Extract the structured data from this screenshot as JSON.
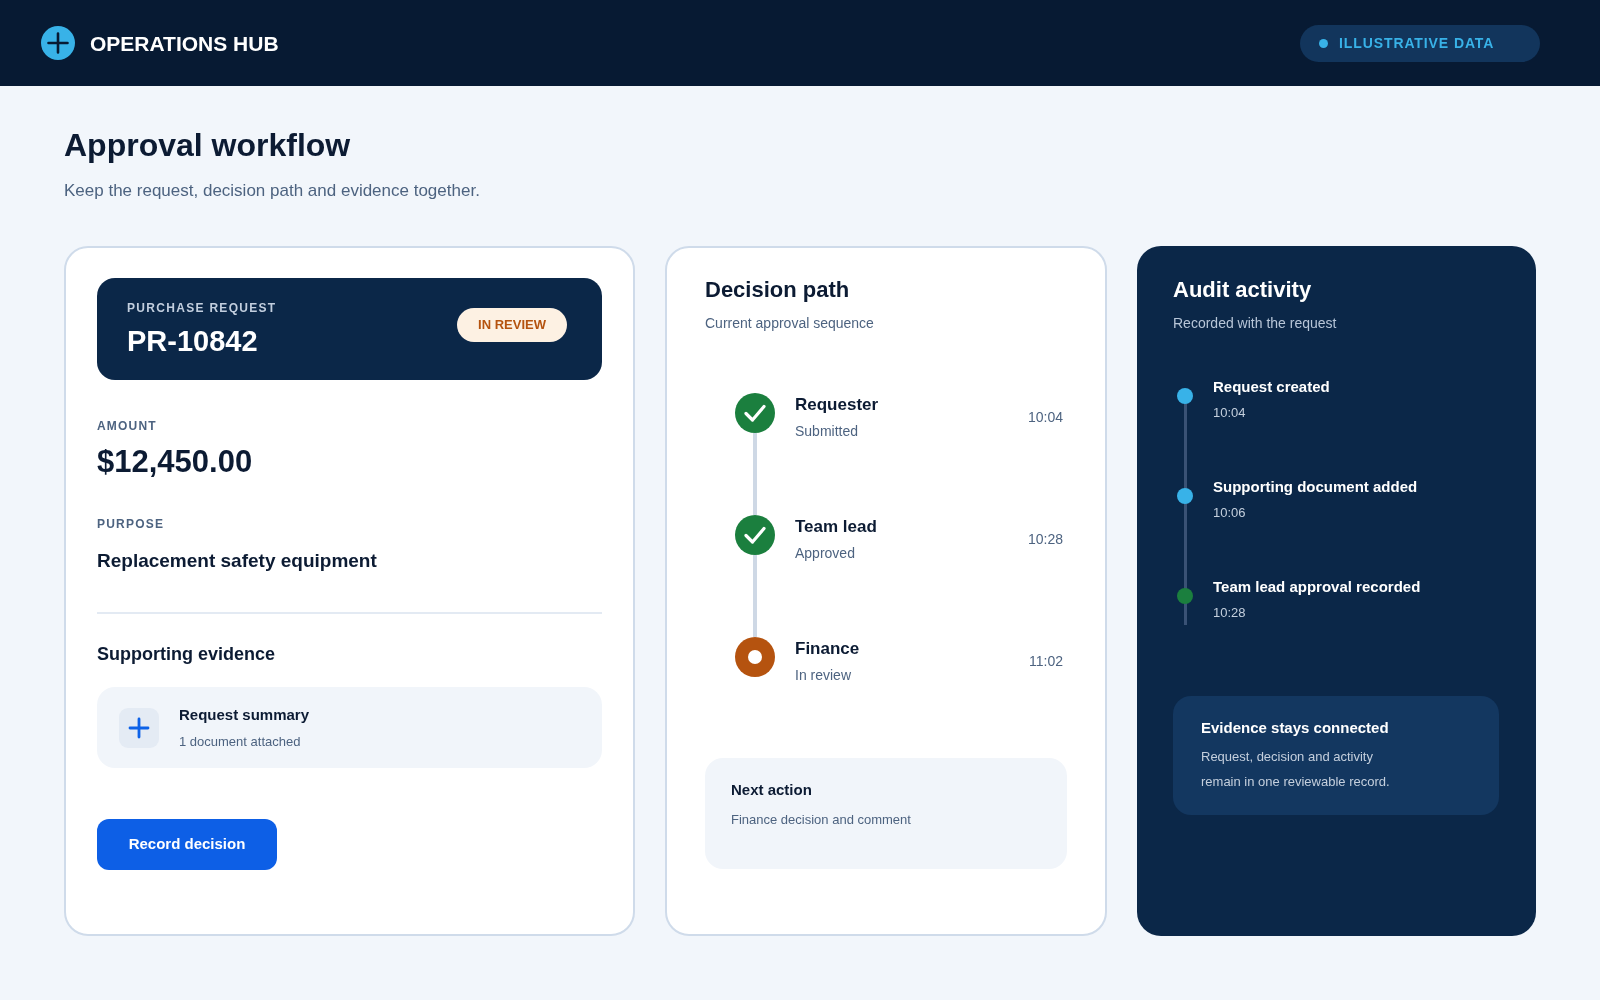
{
  "header": {
    "title": "OPERATIONS HUB",
    "badge": "ILLUSTRATIVE DATA"
  },
  "page": {
    "title": "Approval workflow",
    "subtitle": "Keep the request, decision path and evidence together."
  },
  "request_card": {
    "label": "PURCHASE REQUEST",
    "request_id": "PR-10842",
    "status": "IN REVIEW",
    "fields": [
      {
        "kind": "amount",
        "label": "AMOUNT",
        "value": "$12,450.00"
      },
      {
        "kind": "text",
        "label": "PURPOSE",
        "value": "Replacement safety equipment"
      }
    ],
    "evidence": {
      "title": "Supporting evidence",
      "items": [
        {
          "title": "Request summary",
          "detail": "1 document attached"
        }
      ]
    },
    "button": "Record decision"
  },
  "decision_path": {
    "title": "Decision path",
    "subtitle": "Current approval sequence",
    "steps": [
      {
        "kind": "done",
        "name": "Requester",
        "status": "Submitted",
        "time": "10:04"
      },
      {
        "kind": "done",
        "name": "Team lead",
        "status": "Approved",
        "time": "10:28"
      },
      {
        "kind": "current",
        "name": "Finance",
        "status": "In review",
        "time": "11:02"
      }
    ],
    "next_action": {
      "title": "Next action",
      "detail": "Finance decision and comment"
    }
  },
  "audit": {
    "title": "Audit activity",
    "subtitle": "Recorded with the request",
    "events": [
      {
        "title": "Request created",
        "time": "10:04",
        "color": "#38b2e8"
      },
      {
        "title": "Supporting document added",
        "time": "10:06",
        "color": "#38b2e8"
      },
      {
        "title": "Team lead approval recorded",
        "time": "10:28",
        "color": "#1b7f3e"
      }
    ],
    "note": {
      "title": "Evidence stays connected",
      "body": "Request, decision and activity remain in one reviewable record."
    }
  }
}
